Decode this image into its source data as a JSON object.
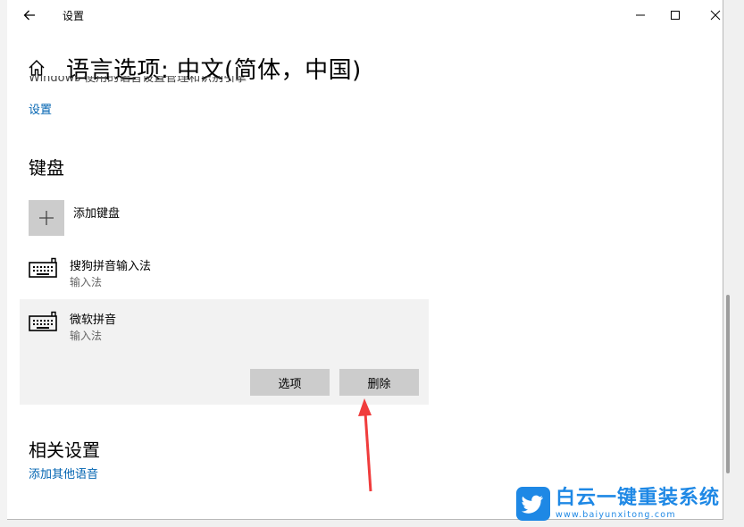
{
  "window": {
    "title": "设置"
  },
  "header": {
    "page_title": "语言选项: 中文(简体，中国)"
  },
  "handwriting": {
    "clipped_text": "Windows 使用的语音设置管理和识别引擎",
    "settings_link": "设置"
  },
  "keyboards": {
    "section_title": "键盘",
    "add_label": "添加键盘",
    "items": [
      {
        "name": "搜狗拼音输入法",
        "type": "输入法"
      },
      {
        "name": "微软拼音",
        "type": "输入法"
      }
    ],
    "options_button": "选项",
    "delete_button": "删除"
  },
  "related": {
    "section_title": "相关设置",
    "add_language_link": "添加其他语音"
  },
  "watermark": {
    "title": "白云一键重装系统",
    "url": "www.baiyunxitong.com"
  },
  "colors": {
    "link": "#0063b1",
    "arrow": "#f03c3c",
    "brand": "#1e88e5"
  }
}
